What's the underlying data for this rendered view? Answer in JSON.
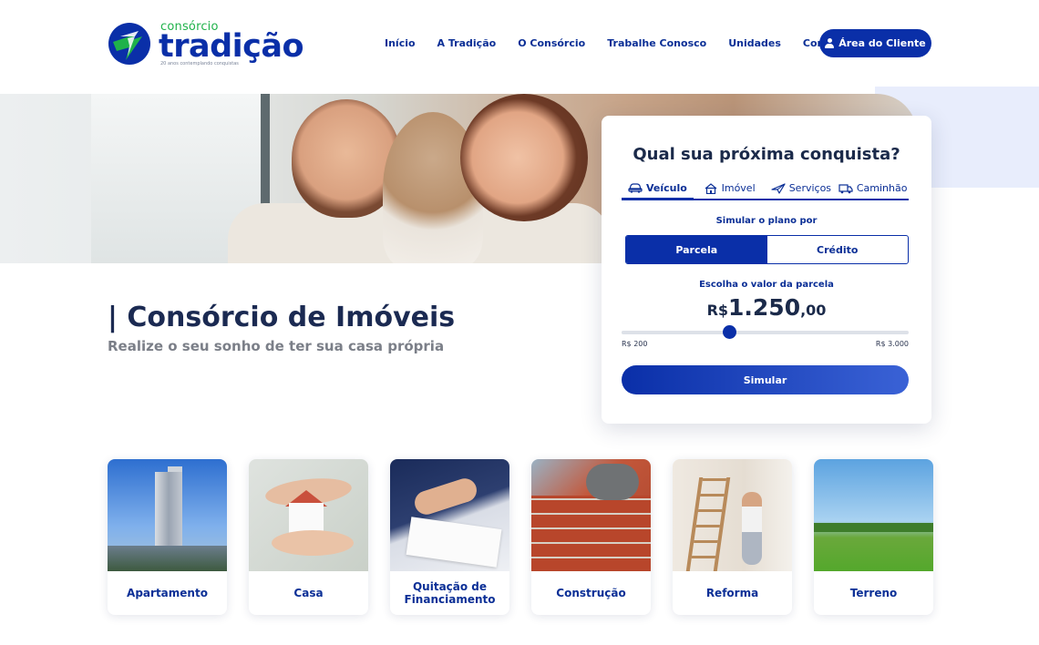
{
  "brand": {
    "small": "consórcio",
    "name": "tradição",
    "tagline": "20 anos contemplando conquistas"
  },
  "nav": {
    "items": [
      "Início",
      "A Tradição",
      "O Consórcio",
      "Trabalhe Conosco",
      "Unidades",
      "Contato"
    ],
    "client_area": "Área do Cliente",
    "client_icon": "user-icon"
  },
  "hero": {
    "title": "| Consórcio de Imóveis",
    "subtitle": "Realize o seu sonho de ter sua casa própria"
  },
  "simulator": {
    "title": "Qual sua próxima conquista?",
    "tabs": [
      {
        "label": "Veículo",
        "icon": "car-icon",
        "active": true
      },
      {
        "label": "Imóvel",
        "icon": "house-icon",
        "active": false
      },
      {
        "label": "Serviços",
        "icon": "plane-icon",
        "active": false
      },
      {
        "label": "Caminhão",
        "icon": "truck-icon",
        "active": false
      }
    ],
    "simulate_by_label": "Simular o plano por",
    "modes": [
      "Parcela",
      "Crédito"
    ],
    "active_mode": "Parcela",
    "choose_value_label": "Escolha o valor da parcela",
    "amount": {
      "currency": "R$",
      "integer": "1.250",
      "decimal": ",00"
    },
    "slider": {
      "min": 200,
      "max": 3000,
      "value": 1250
    },
    "range_min_label": "R$ 200",
    "range_max_label": "R$ 3.000",
    "submit": "Simular"
  },
  "categories": [
    {
      "label": "Apartamento"
    },
    {
      "label": "Casa"
    },
    {
      "label": "Quitação de Financiamento"
    },
    {
      "label": "Construção"
    },
    {
      "label": "Reforma"
    },
    {
      "label": "Terreno"
    }
  ],
  "colors": {
    "primary": "#0a2fa8",
    "accent_green": "#1fb24a",
    "text_dark": "#1b2a4a",
    "hero_bg": "#e8edfc"
  }
}
